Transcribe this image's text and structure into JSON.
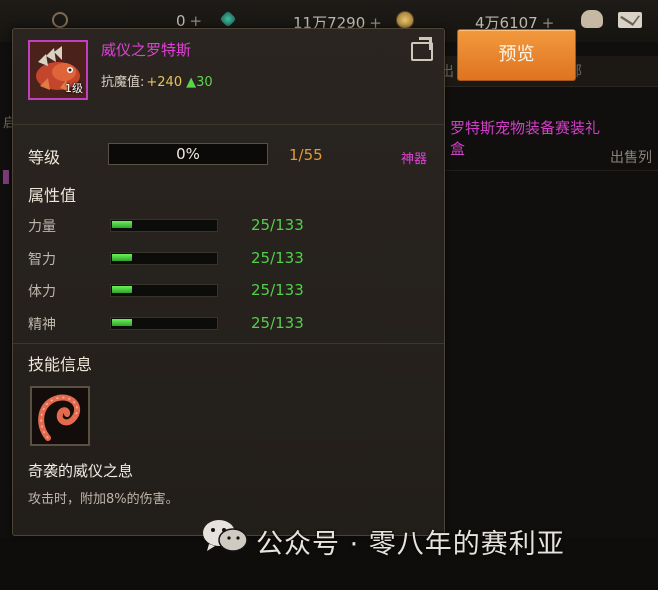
{
  "topbar": {
    "currency_1": "0",
    "currency_2": "11万7290",
    "currency_3": "4万6107",
    "plus": "+",
    "icons": [
      "refresh-icon",
      "gem-icon",
      "coin-icon",
      "bag-icon",
      "mail-icon"
    ]
  },
  "background": {
    "tab_left": "出",
    "tab_right": "部",
    "item_name": "罗特斯宠物装备赛装礼盒",
    "sell_list": "出售列",
    "left_text": "启"
  },
  "preview_button": "预览",
  "tooltip": {
    "pet_name": "威仪之罗特斯",
    "portrait_level": "1级",
    "attr_label": "抗魔值:",
    "attr_value": "+240",
    "attr_bonus": "▲30",
    "level": {
      "label": "等级",
      "progress_text": "0%",
      "progress": 0,
      "count": "1/55",
      "tag": "神器"
    },
    "attributes": {
      "title": "属性值",
      "items": [
        {
          "name": "力量",
          "value": "25/133",
          "fraction": 0.19
        },
        {
          "name": "智力",
          "value": "25/133",
          "fraction": 0.19
        },
        {
          "name": "体力",
          "value": "25/133",
          "fraction": 0.19
        },
        {
          "name": "精神",
          "value": "25/133",
          "fraction": 0.19
        }
      ]
    },
    "skill": {
      "title": "技能信息",
      "name": "奇袭的威仪之息",
      "desc": "攻击时，附加8%的伤害。"
    }
  },
  "watermark": "公众号 · 零八年的赛利亚",
  "colors": {
    "name_purple": "#e040d6",
    "green": "#52d04a",
    "orange": "#e59b32",
    "button_orange": "#e8842e"
  }
}
